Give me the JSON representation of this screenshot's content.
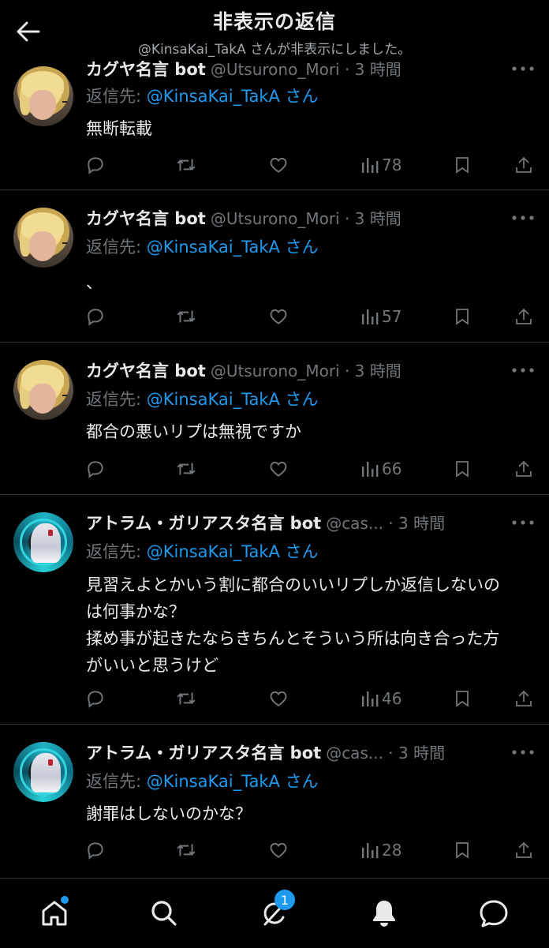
{
  "header": {
    "title": "非表示の返信",
    "subtitle": "@KinsaKai_TakA さんが非表示にしました。"
  },
  "tweets": [
    {
      "name": "カグヤ名言 bot",
      "handle_time": "@Utsurono_Mori · 3 時間",
      "reply_prefix": "返信先: ",
      "reply_mention": "@KinsaKai_TakA さん",
      "text": "無断転載",
      "views": "78"
    },
    {
      "name": "カグヤ名言 bot",
      "handle_time": "@Utsurono_Mori · 3 時間",
      "reply_prefix": "返信先: ",
      "reply_mention": "@KinsaKai_TakA さん",
      "text": "、",
      "views": "57"
    },
    {
      "name": "カグヤ名言 bot",
      "handle_time": "@Utsurono_Mori · 3 時間",
      "reply_prefix": "返信先: ",
      "reply_mention": "@KinsaKai_TakA さん",
      "text": "都合の悪いリプは無視ですか",
      "views": "66"
    },
    {
      "name": "アトラム・ガリアスタ名言 bot",
      "handle_time": "@cas... · 3 時間",
      "reply_prefix": "返信先: ",
      "reply_mention": "@KinsaKai_TakA さん",
      "text": "見習えよとかいう割に都合のいいリプしか返信しないのは何事かな？\n揉め事が起きたならきちんとそういう所は向き合った方がいいと思うけど",
      "views": "46"
    },
    {
      "name": "アトラム・ガリアスタ名言 bot",
      "handle_time": "@cas... · 3 時間",
      "reply_prefix": "返信先: ",
      "reply_mention": "@KinsaKai_TakA さん",
      "text": "謝罪はしないのかな？",
      "views": "28"
    }
  ],
  "nav": {
    "notifications_badge": "1"
  },
  "colors": {
    "background": "#000000",
    "text": "#e7e9ea",
    "muted": "#71767b",
    "accent": "#1d9bf0",
    "divider": "#2f3336"
  },
  "icons": {
    "back": "arrow-left-icon",
    "more": "more-horizontal-icon",
    "reply": "reply-icon",
    "retweet": "retweet-icon",
    "like": "heart-icon",
    "views": "views-bar-chart-icon",
    "bookmark": "bookmark-icon",
    "share": "share-icon",
    "home": "home-icon",
    "search": "search-icon",
    "grok": "grok-icon",
    "notifications": "bell-icon",
    "messages": "message-icon"
  }
}
